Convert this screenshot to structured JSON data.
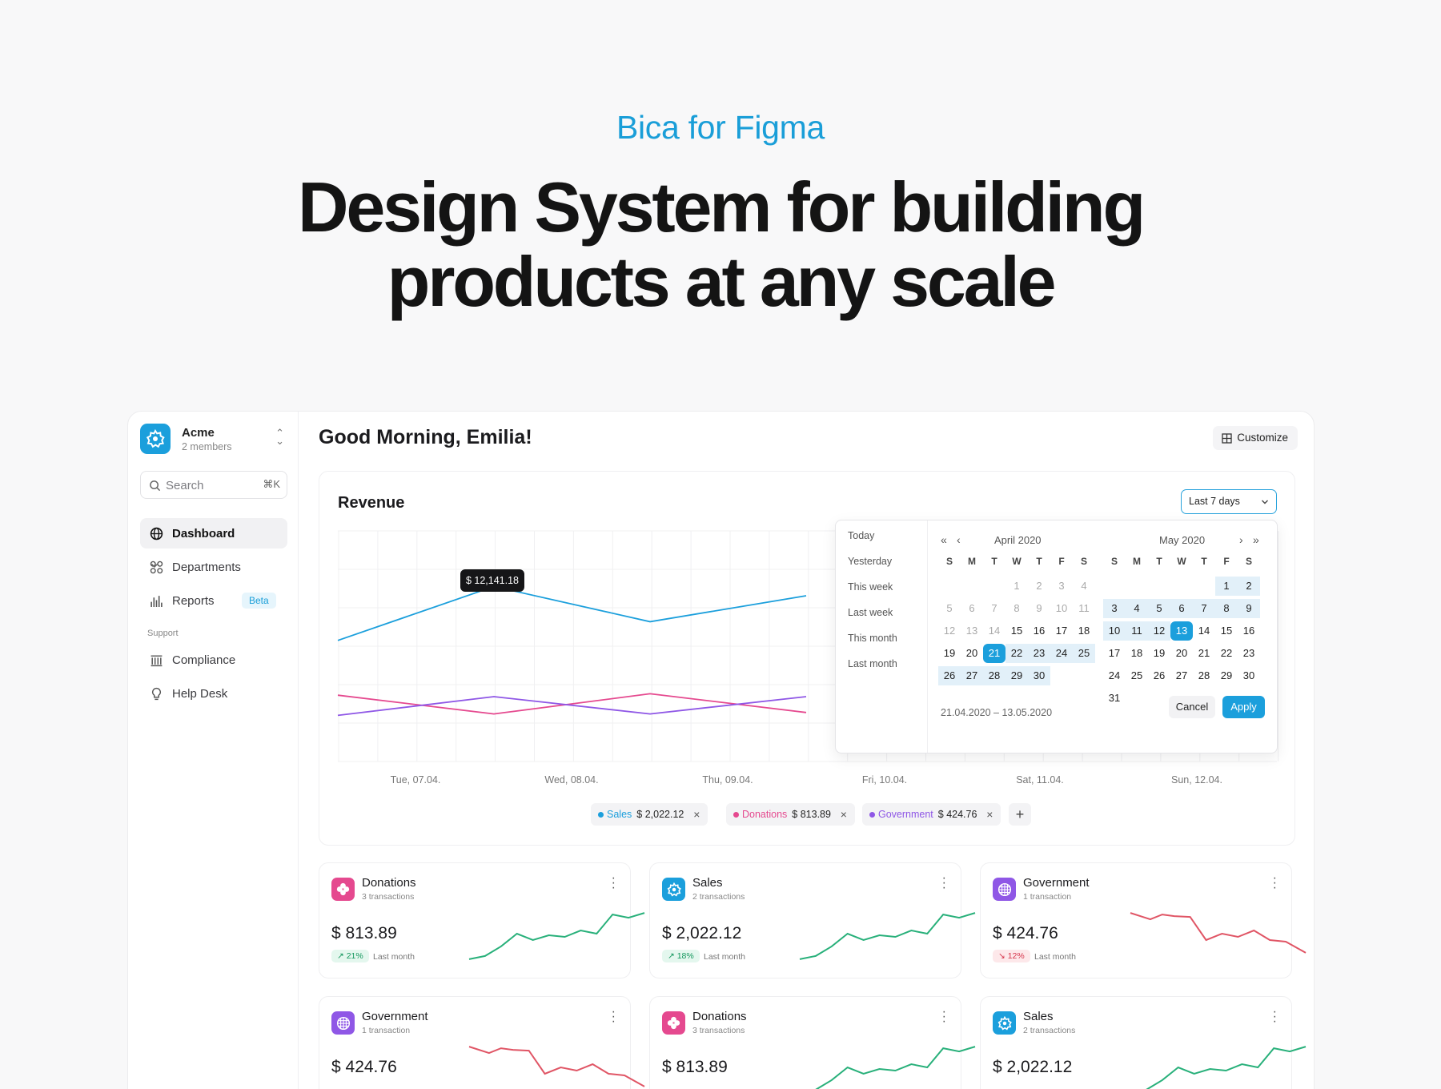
{
  "hero": {
    "tagline": "Bica for Figma",
    "title_line1": "Design System for building",
    "title_line2": "products at any scale"
  },
  "sidebar": {
    "org": {
      "name": "Acme",
      "members": "2 members"
    },
    "search": {
      "placeholder": "Search",
      "shortcut": "⌘K"
    },
    "items": [
      {
        "label": "Dashboard"
      },
      {
        "label": "Departments"
      },
      {
        "label": "Reports",
        "badge": "Beta"
      }
    ],
    "support_label": "Support",
    "support_items": [
      {
        "label": "Compliance"
      },
      {
        "label": "Help Desk"
      }
    ]
  },
  "header": {
    "greeting": "Good Morning, Emilia!",
    "customize": "Customize"
  },
  "revenue": {
    "title": "Revenue",
    "range": "Last 7 days",
    "tooltip": "$ 12,141.18",
    "legend": [
      {
        "name": "Sales",
        "value": "$ 2,022.12",
        "color": "#1b9fdc"
      },
      {
        "name": "Donations",
        "value": "$ 813.89",
        "color": "#e5498f"
      },
      {
        "name": "Government",
        "value": "$ 424.76",
        "color": "#8f57e6"
      }
    ]
  },
  "chart_data": {
    "type": "line",
    "x": [
      "Tue, 07.04.",
      "Wed, 08.04.",
      "Thu, 09.04.",
      "Fri, 10.04.",
      "Sat, 11.04.",
      "Sun, 12.04."
    ],
    "series": [
      {
        "name": "Sales",
        "color": "#1b9fdc",
        "values": [
          8400,
          12141.18,
          9700,
          11500,
          null,
          null
        ]
      },
      {
        "name": "Donations",
        "color": "#e5498f",
        "values": [
          4600,
          3300,
          4700,
          3400,
          null,
          null
        ]
      },
      {
        "name": "Government",
        "color": "#8f57e6",
        "values": [
          3200,
          4500,
          3300,
          4500,
          null,
          null
        ]
      }
    ],
    "grid": true,
    "ylim": [
      0,
      16000
    ]
  },
  "picker": {
    "presets": [
      "Today",
      "Yesterday",
      "This week",
      "Last week",
      "This month",
      "Last month"
    ],
    "left_month": "April 2020",
    "right_month": "May 2020",
    "dow": [
      "S",
      "M",
      "T",
      "W",
      "T",
      "F",
      "S"
    ],
    "range_text": "21.04.2020 – 13.05.2020",
    "cancel": "Cancel",
    "apply": "Apply"
  },
  "metrics": [
    {
      "title": "Donations",
      "sub": "3 transactions",
      "amount": "$ 813.89",
      "change": "21%",
      "dir": "up",
      "period": "Last month",
      "color": "#e5498f",
      "icon": "clover-icon"
    },
    {
      "title": "Sales",
      "sub": "2 transactions",
      "amount": "$ 2,022.12",
      "change": "18%",
      "dir": "up",
      "period": "Last month",
      "color": "#1b9fdc",
      "icon": "gear-icon"
    },
    {
      "title": "Government",
      "sub": "1 transaction",
      "amount": "$ 424.76",
      "change": "12%",
      "dir": "down",
      "period": "Last month",
      "color": "#8f57e6",
      "icon": "grid-icon"
    },
    {
      "title": "Government",
      "sub": "1 transaction",
      "amount": "$ 424.76",
      "change": "",
      "dir": "down",
      "period": "",
      "color": "#8f57e6",
      "icon": "grid-icon"
    },
    {
      "title": "Donations",
      "sub": "3 transactions",
      "amount": "$ 813.89",
      "change": "",
      "dir": "up",
      "period": "",
      "color": "#e5498f",
      "icon": "clover-icon"
    },
    {
      "title": "Sales",
      "sub": "2 transactions",
      "amount": "$ 2,022.12",
      "change": "",
      "dir": "up",
      "period": "",
      "color": "#1b9fdc",
      "icon": "gear-icon"
    }
  ]
}
